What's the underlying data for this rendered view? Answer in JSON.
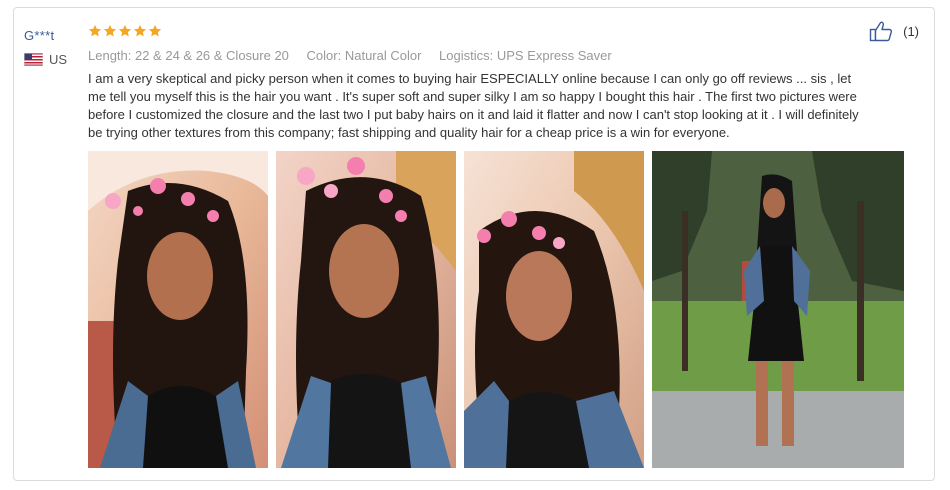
{
  "reviewer": {
    "name": "G***t",
    "country": "US"
  },
  "rating": {
    "stars": 5,
    "max": 5,
    "color": "#f5a623"
  },
  "meta": {
    "length": "Length: 22 & 24 & 26 & Closure 20",
    "color": "Color: Natural Color",
    "logistics": "Logistics: UPS Express Saver"
  },
  "review_text": "I am a very skeptical and picky person when it comes to buying hair ESPECIALLY online because I can only go off reviews ... sis , let me tell you myself this is the hair you want . It's super soft and super silky I am so happy I bought this hair . The first two pictures were before I customized the closure and the last two I put baby hairs on it and laid it flatter and now I can't stop looking at it . I will definitely be trying other textures from this company; fast shipping and quality hair for a cheap price is a win for everyone.",
  "helpful": {
    "icon": "thumbs-up-icon",
    "count": "(1)"
  },
  "photos": [
    {
      "name": "review-photo-1"
    },
    {
      "name": "review-photo-2"
    },
    {
      "name": "review-photo-3"
    },
    {
      "name": "review-photo-4"
    }
  ]
}
